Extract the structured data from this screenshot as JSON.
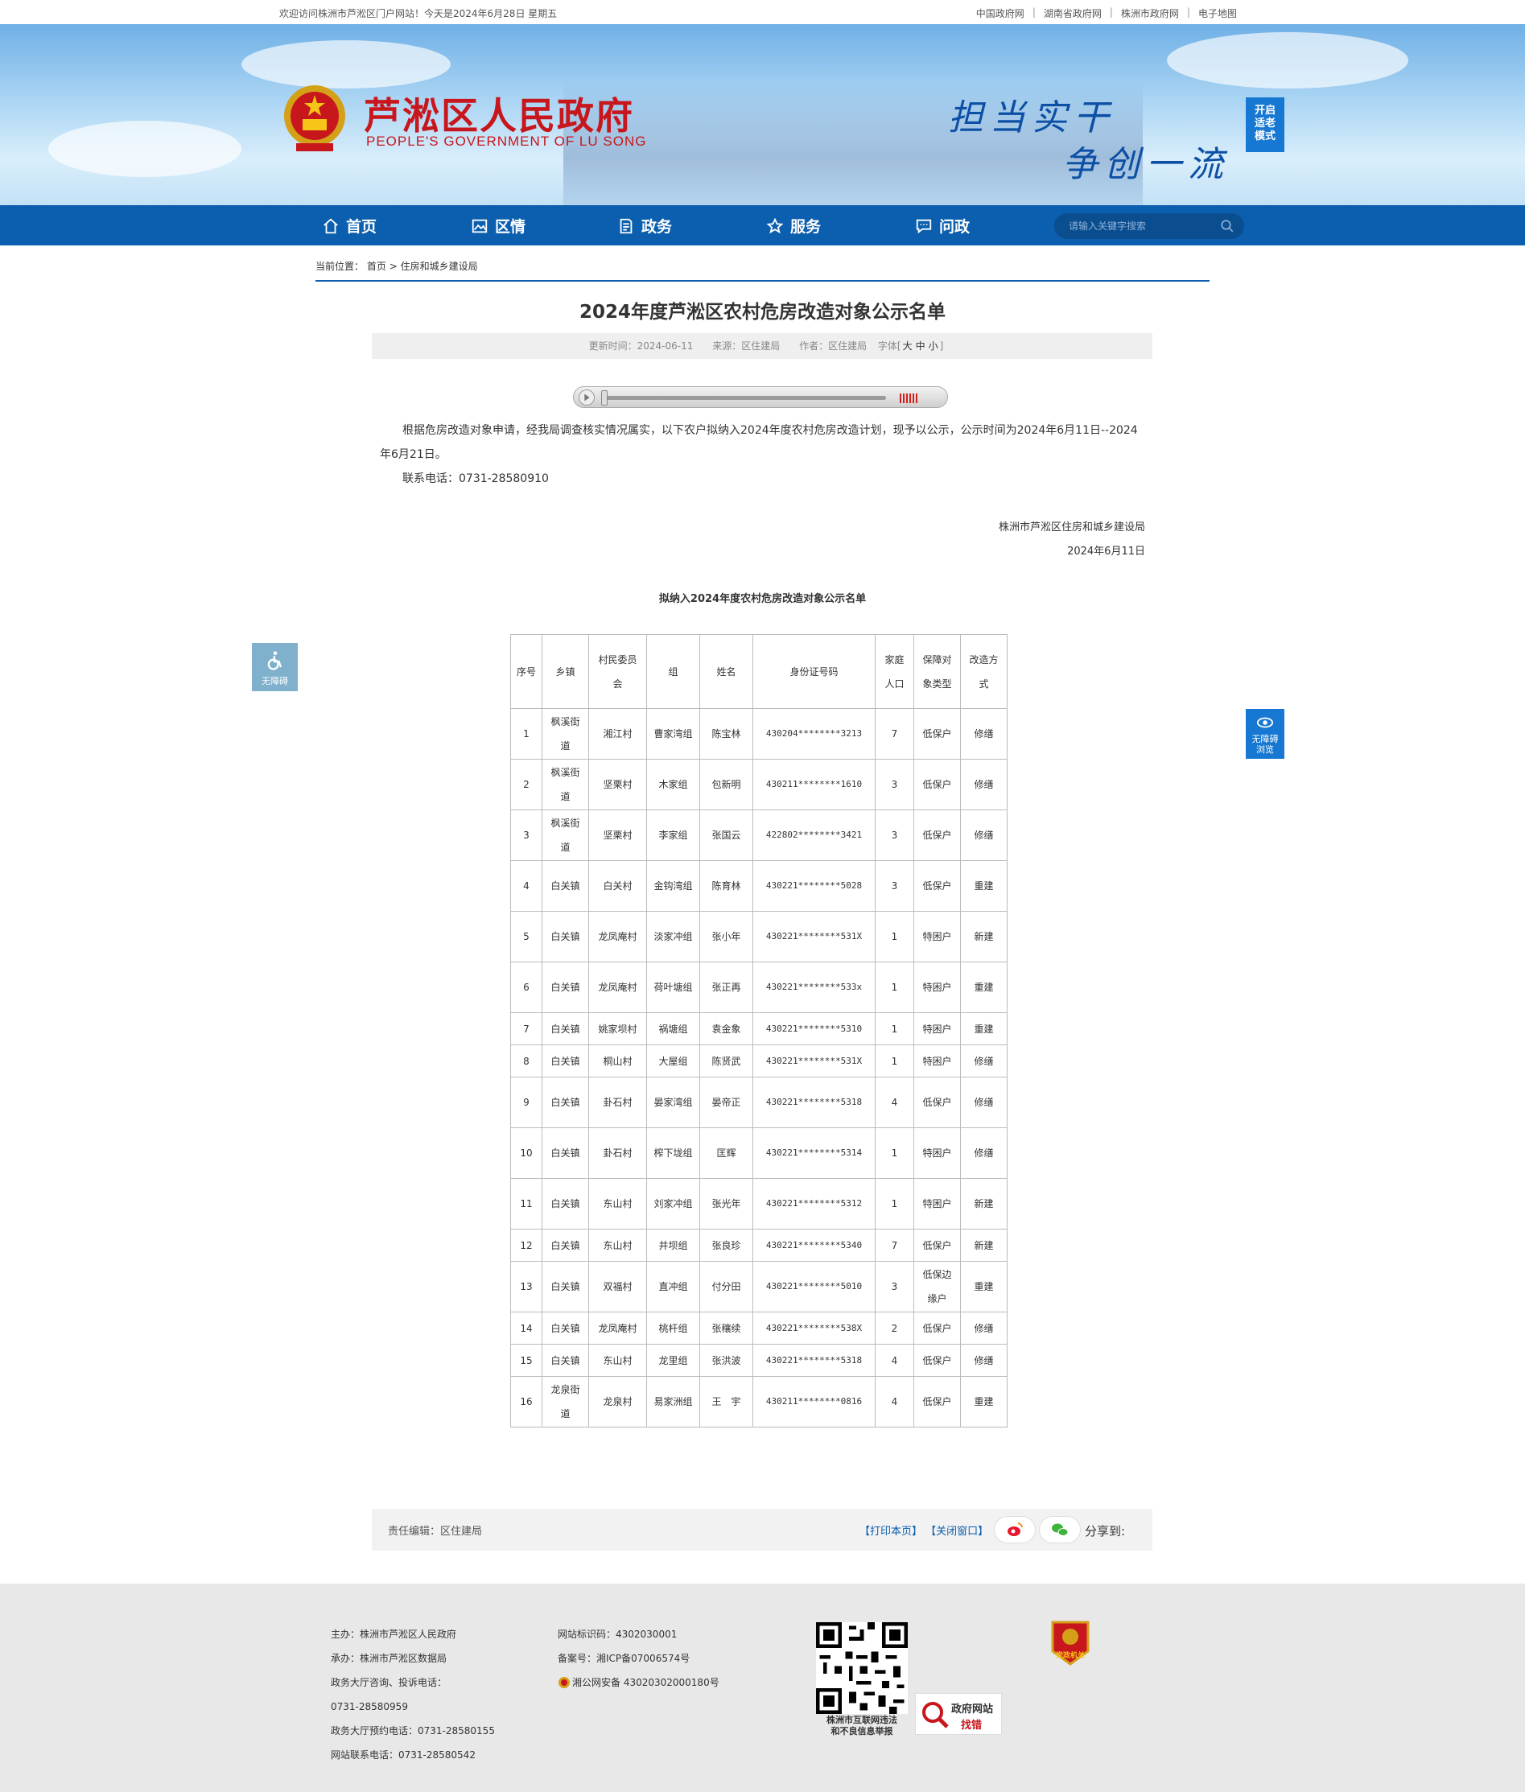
{
  "topbar": {
    "welcome": "欢迎访问株洲市芦淞区门户网站！今天是2024年6月28日 星期五",
    "links": [
      "中国政府网",
      "湖南省政府网",
      "株洲市政府网",
      "电子地图"
    ],
    "sep": "|"
  },
  "header": {
    "title": "芦淞区人民政府",
    "subtitle": "PEOPLE'S GOVERNMENT OF  LU SONG",
    "slogan1": "担当实干",
    "slogan2": "争创一流",
    "elder_mode": [
      "开启",
      "适老",
      "模式"
    ]
  },
  "nav": {
    "items": [
      "首页",
      "区情",
      "政务",
      "服务",
      "问政"
    ],
    "search_placeholder": "请输入关键字搜索"
  },
  "breadcrumb": {
    "label": "当前位置：",
    "home": "首页",
    "gt": ">",
    "section": "住房和城乡建设局"
  },
  "article": {
    "title": "2024年度芦淞区农村危房改造对象公示名单",
    "meta": {
      "updated": "更新时间：2024-06-11",
      "source": "来源：区住建局",
      "author": "作者：区住建局",
      "font_label": "字体[",
      "font_big": "大",
      "font_mid": "中",
      "font_small": "小",
      "font_end": "]"
    },
    "para1": "根据危房改造对象申请，经我局调查核实情况属实，以下农户拟纳入2024年度农村危房改造计划，现予以公示，公示时间为2024年6月11日--2024年6月21日。",
    "contact": "联系电话：0731-28580910",
    "sign_org": "株洲市芦淞区住房和城乡建设局",
    "sign_date": "2024年6月11日",
    "table_title": "拟纳入2024年度农村危房改造对象公示名单"
  },
  "table": {
    "headers": [
      "序号",
      "乡镇",
      "村民委员会",
      "组",
      "姓名",
      "身份证号码",
      "家庭人口",
      "保障对象类型",
      "改造方式"
    ],
    "rows": [
      [
        "1",
        "枫溪街道",
        "湘江村",
        "曹家湾组",
        "陈宝林",
        "430204********3213",
        "7",
        "低保户",
        "修缮"
      ],
      [
        "2",
        "枫溪街道",
        "坚栗村",
        "木家组",
        "包新明",
        "430211********1610",
        "3",
        "低保户",
        "修缮"
      ],
      [
        "3",
        "枫溪街道",
        "坚栗村",
        "李家组",
        "张国云",
        "422802********3421",
        "3",
        "低保户",
        "修缮"
      ],
      [
        "4",
        "白关镇",
        "白关村",
        "金钩湾组",
        "陈育林",
        "430221********5028",
        "3",
        "低保户",
        "重建"
      ],
      [
        "5",
        "白关镇",
        "龙凤庵村",
        "淡家冲组",
        "张小年",
        "430221********531X",
        "1",
        "特困户",
        "新建"
      ],
      [
        "6",
        "白关镇",
        "龙凤庵村",
        "荷叶塘组",
        "张正再",
        "430221********533x",
        "1",
        "特困户",
        "重建"
      ],
      [
        "7",
        "白关镇",
        "姚家坝村",
        "祸塘组",
        "袁金象",
        "430221********5310",
        "1",
        "特困户",
        "重建"
      ],
      [
        "8",
        "白关镇",
        "桐山村",
        "大屋组",
        "陈贤武",
        "430221********531X",
        "1",
        "特困户",
        "修缮"
      ],
      [
        "9",
        "白关镇",
        "卦石村",
        "晏家湾组",
        "晏帝正",
        "430221********5318",
        "4",
        "低保户",
        "修缮"
      ],
      [
        "10",
        "白关镇",
        "卦石村",
        "榨下垅组",
        "匡辉",
        "430221********5314",
        "1",
        "特困户",
        "修缮"
      ],
      [
        "11",
        "白关镇",
        "东山村",
        "刘家冲组",
        "张光年",
        "430221********5312",
        "1",
        "特困户",
        "新建"
      ],
      [
        "12",
        "白关镇",
        "东山村",
        "井坝组",
        "张良珍",
        "430221********5340",
        "7",
        "低保户",
        "新建"
      ],
      [
        "13",
        "白关镇",
        "双福村",
        "直冲组",
        "付分田",
        "430221********5010",
        "3",
        "低保边缘户",
        "重建"
      ],
      [
        "14",
        "白关镇",
        "龙凤庵村",
        "桃杆组",
        "张穰续",
        "430221********538X",
        "2",
        "低保户",
        "修缮"
      ],
      [
        "15",
        "白关镇",
        "东山村",
        "龙里组",
        "张洪波",
        "430221********5318",
        "4",
        "低保户",
        "修缮"
      ],
      [
        "16",
        "龙泉街道",
        "龙泉村",
        "易家洲组",
        "王　宇",
        "430211********0816",
        "4",
        "低保户",
        "重建"
      ]
    ]
  },
  "accessibility": {
    "left": "无障碍",
    "right": [
      "无障碍",
      "浏览"
    ]
  },
  "article_footer": {
    "editor": "责任编辑：区住建局",
    "print": "【打印本页】",
    "close": "【关闭窗口】",
    "share": "分享到:"
  },
  "footer": {
    "col1": [
      "主办：株洲市芦淞区人民政府",
      "承办：株洲市芦淞区数据局",
      "政务大厅咨询、投诉电话：",
      "0731-28580959",
      "政务大厅预约电话：0731-28580155",
      "网站联系电话：0731-28580542"
    ],
    "col2": [
      "网站标识码：4302030001",
      "备案号：湘ICP备07006574号",
      "湘公网安备 43020302000180号"
    ],
    "qr_caption": [
      "株洲市互联网违法",
      "和不良信息举报"
    ],
    "findbug": [
      "政府网站",
      "找错"
    ],
    "party": "党政机关"
  },
  "colors": {
    "nav": "#0b5fae",
    "title_red": "#c8161d",
    "slogan_blue": "#0c4fa5"
  }
}
